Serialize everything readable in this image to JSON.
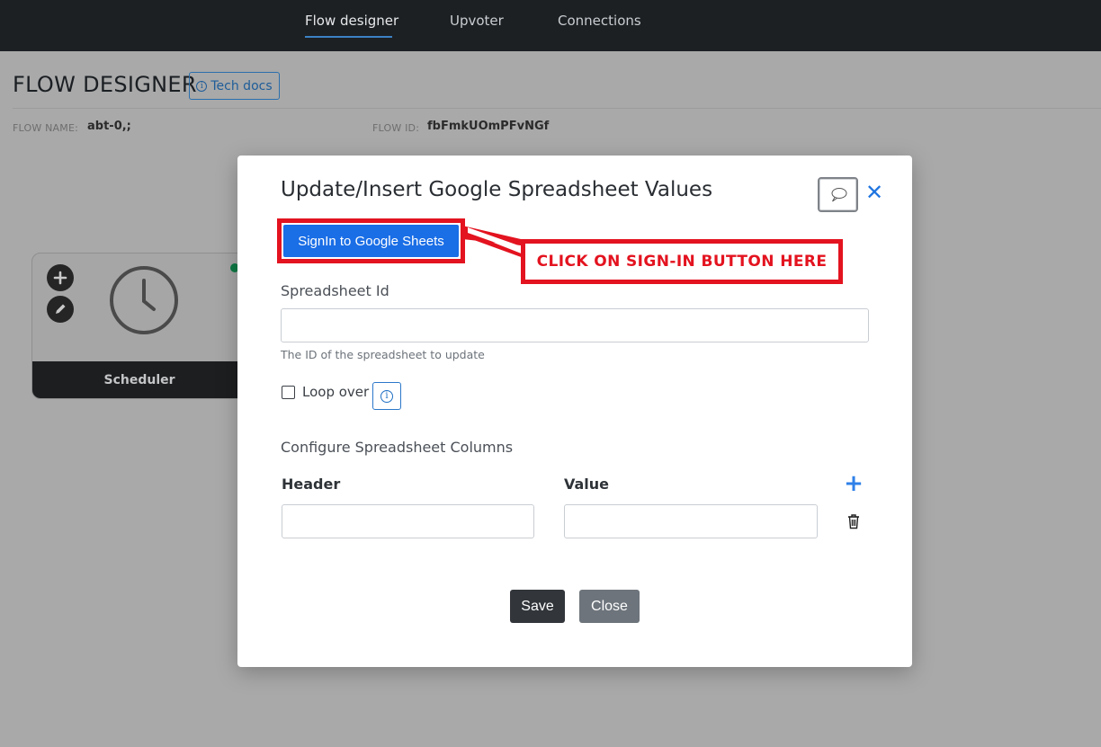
{
  "nav": {
    "tabs": [
      {
        "label": "Flow designer",
        "active": true
      },
      {
        "label": "Upvoter",
        "active": false
      },
      {
        "label": "Connections",
        "active": false
      }
    ]
  },
  "page": {
    "title": "FLOW DESIGNER",
    "tech_docs_label": "Tech docs",
    "flow_name_label": "FLOW NAME:",
    "flow_name_value": "abt-0,;",
    "flow_id_label": "FLOW ID:",
    "flow_id_value": "fbFmkUOmPFvNGf"
  },
  "node": {
    "label": "Scheduler",
    "icon": "clock-icon",
    "status_color": "#0e7a45"
  },
  "modal": {
    "title": "Update/Insert Google Spreadsheet Values",
    "signin_label": "SignIn to Google Sheets",
    "annotation": "CLICK ON SIGN-IN BUTTON HERE",
    "spreadsheet_id_label": "Spreadsheet Id",
    "spreadsheet_id_value": "",
    "spreadsheet_id_help": "The ID of the spreadsheet to update",
    "loop_over_label": "Loop over",
    "loop_over_checked": false,
    "columns_section_label": "Configure Spreadsheet Columns",
    "header_col_label": "Header",
    "value_col_label": "Value",
    "rows": [
      {
        "header": "",
        "value": ""
      }
    ],
    "save_label": "Save",
    "close_label": "Close"
  },
  "colors": {
    "accent": "#1a6ee6",
    "annotation_red": "#e3131f",
    "nav_bg": "#1d2023"
  }
}
